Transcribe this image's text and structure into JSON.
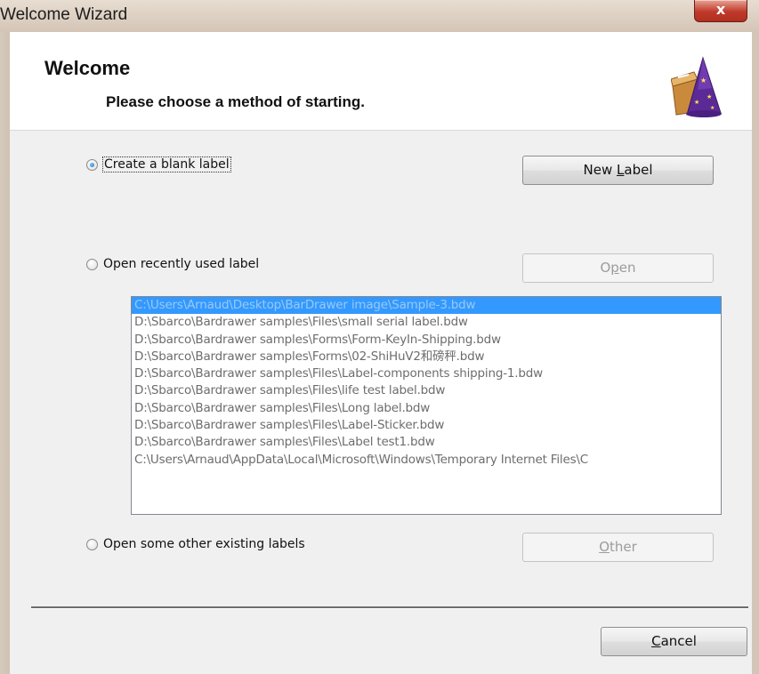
{
  "window": {
    "title": "Welcome Wizard",
    "close_symbol": "x"
  },
  "header": {
    "title": "Welcome",
    "subtitle": "Please choose a method of starting.",
    "icon": "wizard-hat-icon"
  },
  "options": {
    "blank": {
      "label": "Create a blank label",
      "selected": true,
      "button": "New Label",
      "button_mnemonic": "L"
    },
    "recent": {
      "label": "Open recently used label",
      "selected": false,
      "button": "Open",
      "button_mnemonic": "p"
    },
    "other": {
      "label": "Open some other existing labels",
      "selected": false,
      "button": "Other",
      "button_mnemonic": "O"
    }
  },
  "recent_files": [
    "C:\\Users\\Arnaud\\Desktop\\BarDrawer image\\Sample-3.bdw",
    "D:\\Sbarco\\Bardrawer samples\\Files\\small serial label.bdw",
    "D:\\Sbarco\\Bardrawer samples\\Forms\\Form-KeyIn-Shipping.bdw",
    "D:\\Sbarco\\Bardrawer samples\\Forms\\02-ShiHuV2和磅秤.bdw",
    "D:\\Sbarco\\Bardrawer samples\\Files\\Label-components shipping-1.bdw",
    "D:\\Sbarco\\Bardrawer samples\\Files\\life test label.bdw",
    "D:\\Sbarco\\Bardrawer samples\\Files\\Long label.bdw",
    "D:\\Sbarco\\Bardrawer samples\\Files\\Label-Sticker.bdw",
    "D:\\Sbarco\\Bardrawer samples\\Files\\Label test1.bdw",
    "C:\\Users\\Arnaud\\AppData\\Local\\Microsoft\\Windows\\Temporary Internet Files\\C"
  ],
  "footer": {
    "cancel": "Cancel",
    "cancel_mnemonic": "C"
  },
  "colors": {
    "selection": "#3399ff",
    "close_button": "#c0392b"
  }
}
